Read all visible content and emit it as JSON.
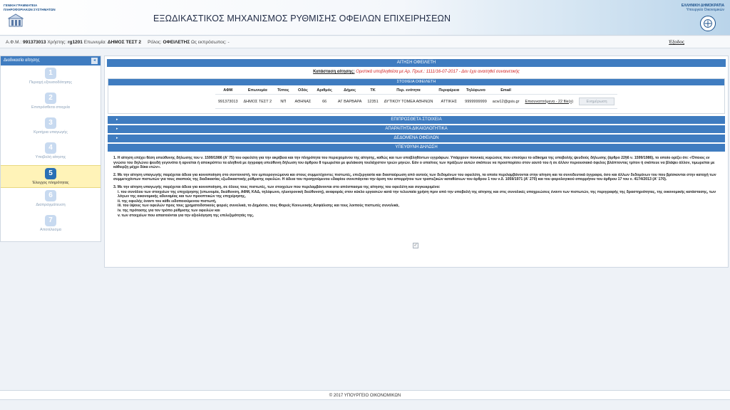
{
  "header": {
    "org_line1": "ΓΕΝΙΚΗ ΓΡΑΜΜΑΤΕΙΑ",
    "org_line2": "ΠΛΗΡΟΦΟΡΙΑΚΩΝ ΣΥΣΤΗΜΑΤΩΝ",
    "title": "ΕΞΩΔΙΚΑΣΤΙΚΟΣ ΜΗΧΑΝΙΣΜΟΣ ΡΥΘΜΙΣΗΣ ΟΦΕΙΛΩΝ ΕΠΙΧΕΙΡΗΣΕΩΝ",
    "gov_line1": "ΕΛΛΗΝΙΚΗ ΔΗΜΟΚΡΑΤΙΑ",
    "gov_line2": "Υπουργείο Οικονομικών"
  },
  "userbar": {
    "afm_label": "Α.Φ.Μ.:",
    "afm": "991373013",
    "user_label": "Χρήστης:",
    "user": "rg1201",
    "name_label": "Επωνυμία:",
    "name": "ΔΗΜΟΣ ΤΕΣΤ 2",
    "role_label": "Ρόλος:",
    "role": "ΟΦΕΙΛΕΤΗΣ",
    "rep_label": "Ως εκπρόσωπος:",
    "rep": "-",
    "logout": "Έξοδος"
  },
  "sidebar": {
    "title": "Διαδικασία αίτησης",
    "collapse_icon": "◂",
    "steps": [
      {
        "num": "1",
        "label": "Περιοχή εξουσιοδότησης"
      },
      {
        "num": "2",
        "label": "Επιπρόσθετα στοιχεία"
      },
      {
        "num": "3",
        "label": "Κριτήρια υπαγωγής"
      },
      {
        "num": "4",
        "label": "Υποβολή αίτησης"
      },
      {
        "num": "5",
        "label": "Έλεγχος πληρότητας"
      },
      {
        "num": "6",
        "label": "Διαπραγμάτευση"
      },
      {
        "num": "7",
        "label": "Αποτέλεσμα"
      }
    ]
  },
  "main": {
    "title": "ΑΙΤΗΣΗ ΟΦΕΙΛΕΤΗ",
    "status_label": "Κατάσταση αίτησης:",
    "status_value": "Οριστικά υποβληθείσα με Αρ. Πρωτ.: 1111/16-07-2017 - Δεν έχει αναιτηθεί συναινετικής",
    "debtor_panel_title": "ΣΤΟΙΧΕΙΑ ΟΦΕΙΛΕΤΗ",
    "columns": [
      "ΑΦΜ",
      "Επωνυμία",
      "Τύπος",
      "Οδός",
      "Αριθμός",
      "Δήμος",
      "ΤΚ",
      "Περ. ενότητα",
      "Περιφέρεια",
      "Τηλέφωνο",
      "Email"
    ],
    "row": [
      "991373013",
      "ΔΗΜΟΣ ΤΕΣΤ 2",
      "ΝΠ",
      "ΑΘΗΝΑΣ",
      "66",
      "ΑΓ ΒΑΡΒΑΡΑ",
      "12351",
      "ΔΥΤΙΚΟΥ ΤΟΜΕΑ ΑΘΗΝΩΝ",
      "ΑΤΤΙΚΗΣ",
      "9999999999",
      "acw12@gsis.gr"
    ],
    "attachments_link": "Επισυναπτόμενα - 22 file(s)",
    "update_button": "Ενημέρωση",
    "sections": [
      "ΕΠΙΠΡΟΣΘΕΤΑ ΣΤΟΙΧΕΙΑ",
      "ΑΠΑΡΑΙΤΗΤΑ ΔΙΚΑΙΟΛΟΓΗΤΙΚΑ",
      "ΔΕΔΟΜΕΝΑ ΟΦΕΙΛΩΝ"
    ],
    "section_arrow_icon": "▸",
    "declaration_title": "ΥΠΕΥΘΥΝΗ ΔΗΛΩΣΗ",
    "decl_p1": "1. Η αίτηση επέχει θέση υπεύθυνης δήλωσης του ν. 1599/1986 (Α' 75) του οφειλέτη για την ακρίβεια και την πληρότητα του περιεχομένου της αίτησης, καθώς και των υποβληθέντων εγγράφων. Υπάρχουν ποινικές κυρώσεις που επισύρει το αδίκημα της υποβολής ψευδούς δήλωσης (άρθρο 22§6 ν. 1599/1986), το οποίο ορίζει ότι: «Όποιος εν γνώσει του δηλώνει ψευδή γεγονότα ή αρνείται ή αποκρύπτει τα αληθινά με έγγραφη υπεύθυνη δήλωση του άρθρου 8 τιμωρείται με φυλάκιση τουλάχιστον τριών μηνών. Εάν ο υπαίτιος των πράξεων αυτών σκόπευε να προσπορίσει στον εαυτό του ή σε άλλον περιουσιακό όφελος βλάπτοντας τρίτον ή σκόπευε να βλάψει άλλον, τιμωρείται με κάθειρξη μέχρι δέκα ετών».",
    "decl_p2": "2. Με την αίτηση υπαγωγής παρέχεται άδεια για κοινοποίηση στο συντονιστή, τον εμπειρογνώμονα και στους συμμετέχοντες πιστωτές, επεξεργασία και διασταύρωση από αυτούς των δεδομένων του οφειλέτη, τα οποία περιλαμβάνονται στην αίτηση και τα συνοδευτικά έγγραφα, όσο και άλλων δεδομένων του που βρίσκονται στην κατοχή των συμμετεχόντων πιστωτών για τους σκοπούς της διαδικασίας εξωδικαστικής ρύθμισης οφειλών. Η άδεια του προηγούμενου εδαφίου συνεπάγεται την άρση του απορρήτου των τραπεζικών καταθέσεων του άρθρου 1 του ν.δ. 1059/1971 (Α' 270) και του φορολογικού απορρήτου του άρθρου 17 του ν. 4174/2013 (Α' 170).",
    "decl_p3": "3. Με την αίτηση υπαγωγής παρέχεται άδεια για κοινοποίηση, σε όλους τους πιστωτές, των στοιχείων που περιλαμβάνονται στο απόσπασμα της αίτησης του οφειλέτη και συγκεκριμένα:",
    "decl_items": [
      "i. του συνόλου των στοιχείων της επιχείρησης (επωνυμία, διεύθυνση, ΑΦΜ, ΚΑΔ, τηλέφωνο, ηλεκτρονική διεύθυνση), αναφοράς στον κύκλο εργασιών κατά την τελευταία χρήση πριν από την υποβολή της αίτησης και στις συνολικές υποχρεώσεις έναντι των πιστωτών, της περιγραφής της δραστηριότητας, της οικονομικής κατάστασης, των λόγων της οικονομικής αδυναμίας και των προοπτικών της επιχείρησης,",
      "ii. της οφειλής έναντι του κάθε ειδοποιούμενου πιστωτή,",
      "iii. του ύψους των οφειλών προς τους χρηματοδοτικούς φορείς συνολικά, το Δημόσιο, τους Φορείς Κοινωνικής Ασφάλισης και τους λοιπούς πιστωτές συνολικά,",
      "iv. της πρότασης για τον τρόπο ρύθμισης των οφειλών και",
      "v. των στοιχείων που απαιτούνται για την αξιολόγηση της επιλεξιμότητάς της."
    ],
    "checkbox_mark": "✓"
  },
  "footer": {
    "text": "© 2017 ΥΠΟΥΡΓΕΙΟ ΟΙΚΟΝΟΜΙΚΩΝ"
  }
}
